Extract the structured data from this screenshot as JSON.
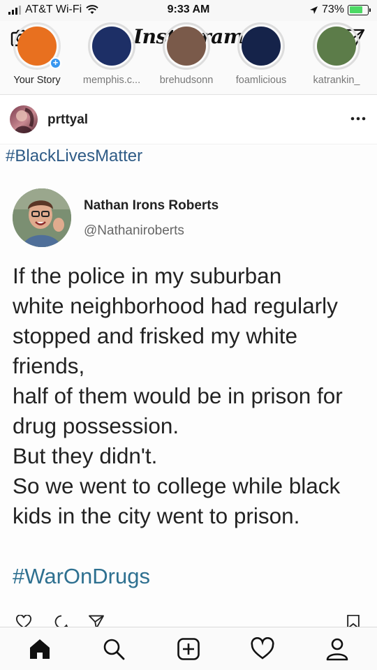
{
  "status_bar": {
    "carrier": "AT&T Wi-Fi",
    "time": "9:33 AM",
    "battery_percent": "73%",
    "battery_level": 0.73,
    "battery_color": "#4cd964"
  },
  "header": {
    "logo": "Instagram",
    "left_icon": "camera-icon",
    "right_icon": "direct-message-icon"
  },
  "stories": [
    {
      "label": "Your Story",
      "own": true,
      "color": "#e8701f"
    },
    {
      "label": "memphis.c...",
      "own": false,
      "color": "#1d2f66"
    },
    {
      "label": "brehudsonn",
      "own": false,
      "color": "#7a5a4a"
    },
    {
      "label": "foamlicious",
      "own": false,
      "color": "#15234a"
    },
    {
      "label": "katrankin_",
      "own": false,
      "color": "#5c7c49"
    }
  ],
  "post": {
    "username": "prttyal",
    "caption_hashtag": "#BlackLivesMatter",
    "tweet": {
      "name": "Nathan Irons Roberts",
      "handle": "@Nathaniroberts",
      "lines": [
        "If the police in my suburban",
        "white neighborhood had regularly",
        "stopped and frisked my white",
        "friends,",
        "half of them would be in prison for",
        "drug possession.",
        "But they didn't.",
        "So we went to college while black",
        "kids in the city went to prison."
      ],
      "hashtag": "#WarOnDrugs"
    },
    "actions": [
      "heart-icon",
      "comment-icon",
      "share-icon",
      "bookmark-icon"
    ]
  },
  "bottom_nav": [
    "home-icon",
    "search-icon",
    "new-post-icon",
    "activity-icon",
    "profile-icon"
  ],
  "colors": {
    "hashtag_top": "#2e5b86",
    "hashtag_bottom": "#2e7090",
    "story_badge": "#3897f0"
  }
}
